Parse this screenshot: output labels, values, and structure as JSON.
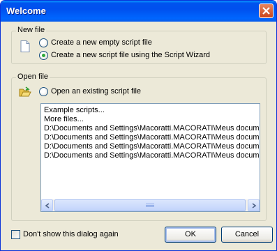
{
  "window": {
    "title": "Welcome"
  },
  "new_file": {
    "label": "New file",
    "options": [
      {
        "label": "Create a new empty script file",
        "checked": false
      },
      {
        "label": "Create a new script file using the Script Wizard",
        "checked": true
      }
    ],
    "icon": "document-icon"
  },
  "open_file": {
    "label": "Open an existing script file",
    "group_label": "Open file",
    "checked": false,
    "icon": "open-folder-icon",
    "items": [
      "Example scripts...",
      "More files...",
      "D:\\Documents and Settings\\Macoratti.MACORATI\\Meus docume",
      "D:\\Documents and Settings\\Macoratti.MACORATI\\Meus docume",
      "D:\\Documents and Settings\\Macoratti.MACORATI\\Meus docume",
      "D:\\Documents and Settings\\Macoratti.MACORATI\\Meus docume"
    ]
  },
  "footer": {
    "dont_show_label": "Don't show this dialog again",
    "dont_show_checked": false,
    "ok_label": "OK",
    "cancel_label": "Cancel"
  },
  "colors": {
    "titlebar": "#0053ee",
    "dialog_bg": "#ece9d8",
    "close": "#e0603a"
  }
}
